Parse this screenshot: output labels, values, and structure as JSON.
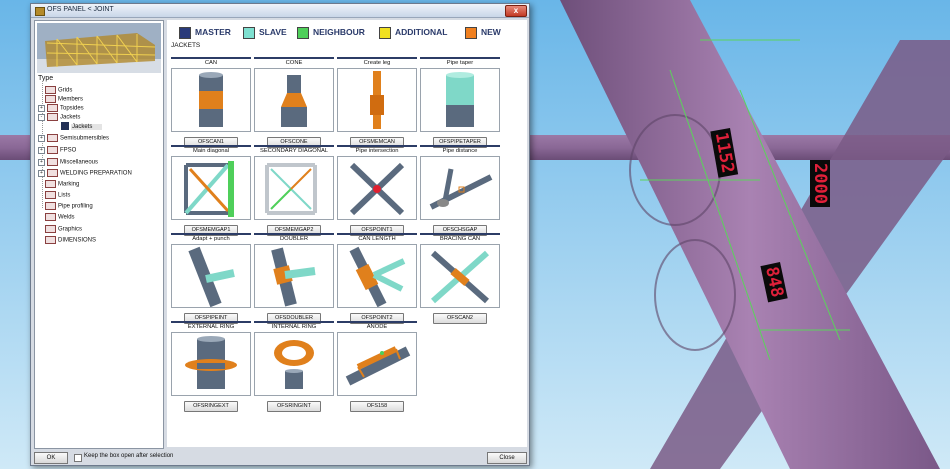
{
  "window": {
    "title": "OFS PANEL < JOINT",
    "close_glyph": "x"
  },
  "viewport": {
    "dimensions": [
      "1152",
      "2000",
      "848"
    ]
  },
  "tree": {
    "label": "Type",
    "items": [
      {
        "label": "Grids",
        "icon": "grid-icon"
      },
      {
        "label": "Members",
        "icon": "members-icon"
      },
      {
        "label": "Topsides",
        "icon": "topsides-icon"
      },
      {
        "label": "Jackets",
        "icon": "jackets-icon"
      },
      {
        "label": "Jackets",
        "icon": "jackets-child-icon"
      },
      {
        "label": "Semisubmersibles",
        "icon": "semisub-icon"
      },
      {
        "label": "FPSO",
        "icon": "fpso-icon"
      },
      {
        "label": "Miscellaneous",
        "icon": "misc-icon"
      },
      {
        "label": "WELDING PREPARATION",
        "icon": "welding-icon"
      },
      {
        "label": "Marking",
        "icon": "marking-icon"
      },
      {
        "label": "Lists",
        "icon": "lists-icon"
      },
      {
        "label": "Pipe profiling",
        "icon": "profiling-icon"
      },
      {
        "label": "Welds",
        "icon": "welds-icon"
      },
      {
        "label": "Graphics",
        "icon": "graphics-icon"
      },
      {
        "label": "DIMENSIONS",
        "icon": "dimensions-icon"
      }
    ]
  },
  "tabs": [
    {
      "label": "MASTER",
      "color": "#2a3a7a"
    },
    {
      "label": "SLAVE",
      "color": "#7ee0d0"
    },
    {
      "label": "NEIGHBOUR",
      "color": "#4fcf5a"
    },
    {
      "label": "ADDITIONAL",
      "color": "#f0e020"
    },
    {
      "label": "NEW",
      "color": "#f08020"
    }
  ],
  "section_label": "JACKETS",
  "cards": [
    {
      "title": "CAN",
      "button": "OFSCAN1"
    },
    {
      "title": "CONE",
      "button": "OFSCONE"
    },
    {
      "title": "Create leg",
      "button": "OFSMEMCAN"
    },
    {
      "title": "Pipe taper",
      "button": "OFSPIPETAPER"
    },
    {
      "title": "Main diagonal",
      "button": "OFSMEMGAP1"
    },
    {
      "title": "SECONDARY DIAGONAL",
      "button": "OFSMEMGAP2"
    },
    {
      "title": "Pipe intersection",
      "button": "OFSPOINT1"
    },
    {
      "title": "Pipe distance",
      "button": "OFSCHSGAP"
    },
    {
      "title": "Adapt + punch",
      "button": "OFSPIPEINT"
    },
    {
      "title": "DOUBLER",
      "button": "OFSDOUBLER"
    },
    {
      "title": "CAN LENGTH",
      "button": "OFSPOINT2"
    },
    {
      "title": "BRACING CAN",
      "button": "OFSCAN2"
    },
    {
      "title": "EXTERNAL RING",
      "button": "OFSRINGEXT"
    },
    {
      "title": "INTERNAL RING",
      "button": "OFSRINGINT"
    },
    {
      "title": "ANODE",
      "button": "OFS158"
    }
  ],
  "footer": {
    "ok": "OK",
    "keep_open": "Keep the box open after selection",
    "close": "Close"
  }
}
